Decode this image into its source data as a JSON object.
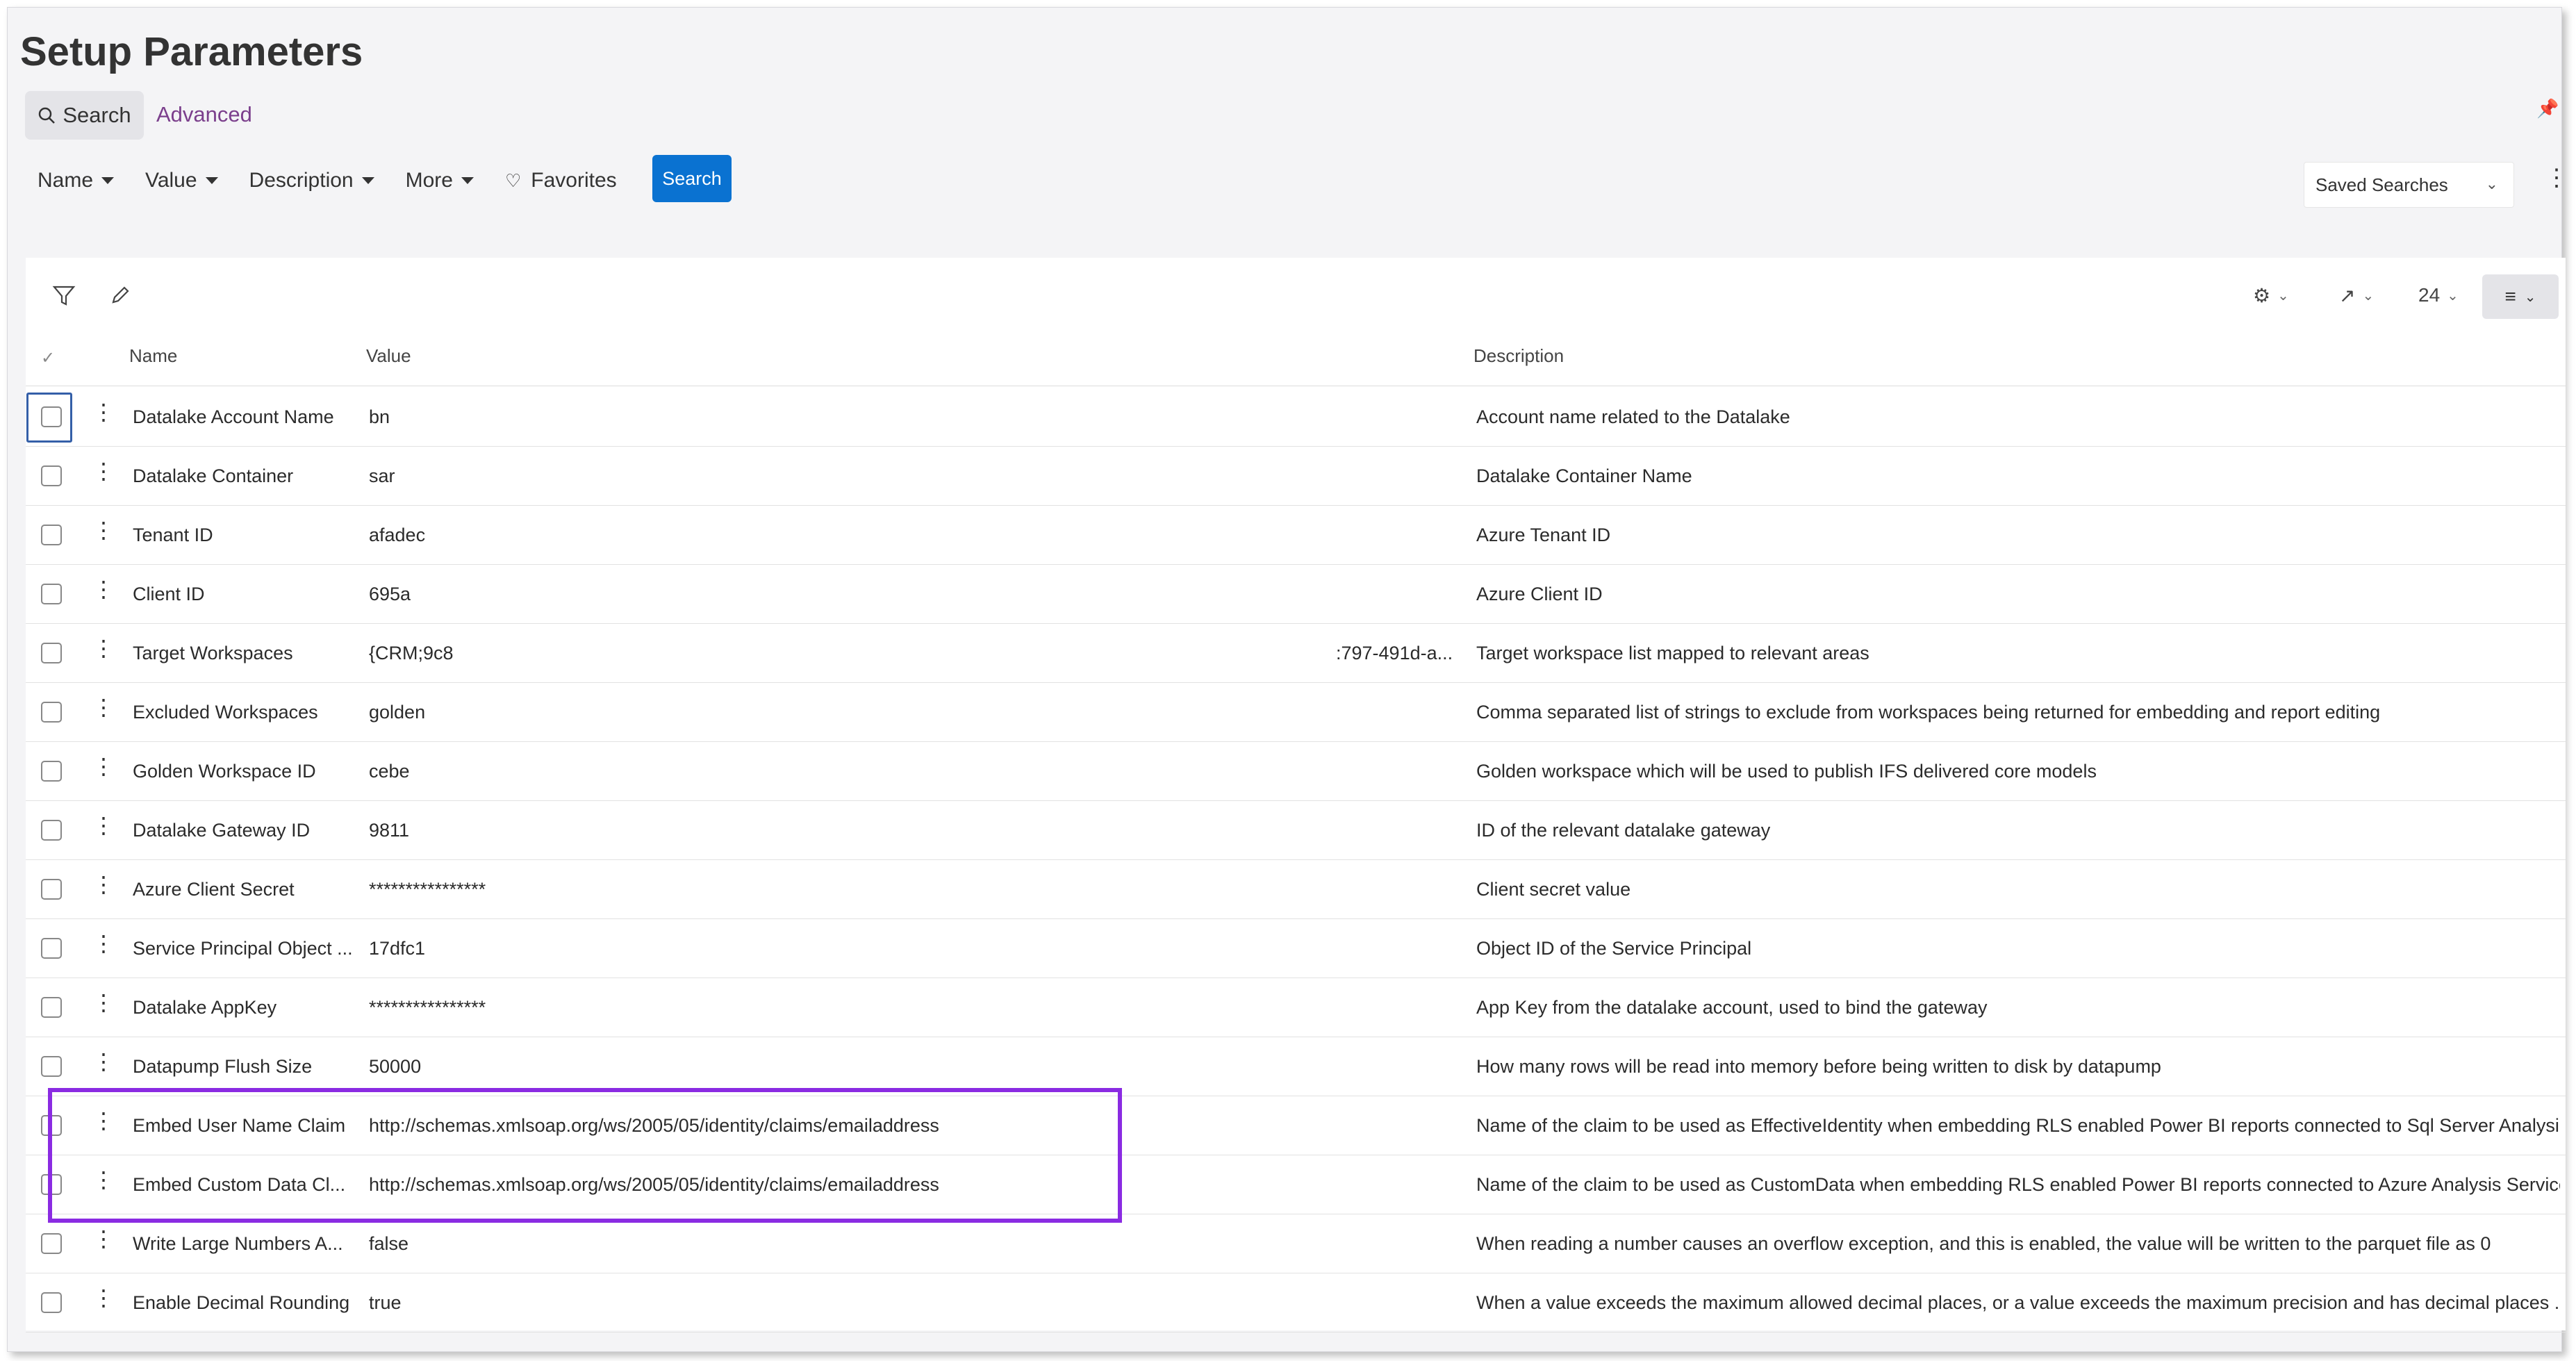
{
  "page": {
    "title": "Setup Parameters",
    "search_tab": "Search",
    "advanced_link": "Advanced"
  },
  "filters": {
    "name": "Name",
    "value": "Value",
    "description": "Description",
    "more": "More",
    "favorites": "Favorites",
    "search_button": "Search",
    "saved_searches": "Saved Searches"
  },
  "toolbar": {
    "page_size": "24"
  },
  "columns": {
    "name": "Name",
    "value": "Value",
    "description": "Description"
  },
  "rows": [
    {
      "name": "Datalake Account Name",
      "value": "bn",
      "value_extra": "",
      "description": "Account name related to the Datalake"
    },
    {
      "name": "Datalake Container",
      "value": "sar",
      "value_extra": "",
      "description": "Datalake Container Name"
    },
    {
      "name": "Tenant ID",
      "value": "afadec",
      "value_extra": "",
      "description": "Azure Tenant ID"
    },
    {
      "name": "Client ID",
      "value": "695a",
      "value_extra": "",
      "description": "Azure Client ID"
    },
    {
      "name": "Target Workspaces",
      "value": "{CRM;9c8",
      "value_extra": ":797-491d-a...",
      "description": "Target workspace list mapped to relevant areas"
    },
    {
      "name": "Excluded Workspaces",
      "value": "golden",
      "value_extra": "",
      "description": "Comma separated list of strings to exclude from workspaces being returned for embedding and report editing"
    },
    {
      "name": "Golden Workspace ID",
      "value": "cebe",
      "value_extra": "",
      "description": "Golden workspace which will be used to publish IFS delivered core models"
    },
    {
      "name": "Datalake Gateway ID",
      "value": "9811",
      "value_extra": "",
      "description": "ID of the relevant datalake gateway"
    },
    {
      "name": "Azure Client Secret",
      "value": "****************",
      "value_extra": "",
      "description": "Client secret value"
    },
    {
      "name": "Service Principal Object ...",
      "value": "17dfc1",
      "value_extra": "",
      "description": "Object ID of the Service Principal"
    },
    {
      "name": "Datalake AppKey",
      "value": "****************",
      "value_extra": "",
      "description": "App Key from the datalake account, used to bind the gateway"
    },
    {
      "name": "Datapump Flush Size",
      "value": "50000",
      "value_extra": "",
      "description": "How many rows will be read into memory before being written to disk by datapump"
    },
    {
      "name": "Embed User Name Claim",
      "value": "http://schemas.xmlsoap.org/ws/2005/05/identity/claims/emailaddress",
      "value_extra": "",
      "description": "Name of the claim to be used as EffectiveIdentity when embedding RLS enabled Power BI reports connected to Sql Server Analysi..."
    },
    {
      "name": "Embed Custom Data Cl...",
      "value": "http://schemas.xmlsoap.org/ws/2005/05/identity/claims/emailaddress",
      "value_extra": "",
      "description": "Name of the claim to be used as CustomData when embedding RLS enabled Power BI reports connected to Azure Analysis Services"
    },
    {
      "name": "Write Large Numbers A...",
      "value": "false",
      "value_extra": "",
      "description": "When reading a number causes an overflow exception, and this is enabled, the value will be written to the parquet file as 0"
    },
    {
      "name": "Enable Decimal Rounding",
      "value": "true",
      "value_extra": "",
      "description": "When a value exceeds the maximum allowed decimal places, or a value exceeds the maximum precision and has decimal places ..."
    }
  ],
  "colors": {
    "accent": "#0a72d1",
    "advanced_link": "#7b3f8c",
    "highlight_box": "#8a2be2"
  }
}
